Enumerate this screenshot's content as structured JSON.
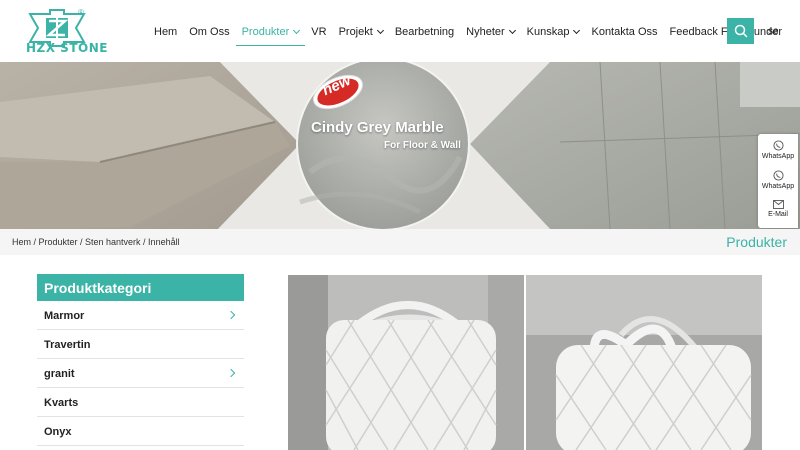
{
  "brand": {
    "name": "HZX STONE",
    "registered": "®",
    "color": "#3bb3a6"
  },
  "nav": {
    "items": [
      {
        "label": "Hem",
        "dropdown": false,
        "active": false
      },
      {
        "label": "Om Oss",
        "dropdown": false,
        "active": false
      },
      {
        "label": "Produkter",
        "dropdown": true,
        "active": true
      },
      {
        "label": "VR",
        "dropdown": false,
        "active": false
      },
      {
        "label": "Projekt",
        "dropdown": true,
        "active": false
      },
      {
        "label": "Bearbetning",
        "dropdown": false,
        "active": false
      },
      {
        "label": "Nyheter",
        "dropdown": true,
        "active": false
      },
      {
        "label": "Kunskap",
        "dropdown": true,
        "active": false
      },
      {
        "label": "Kontakta Oss",
        "dropdown": false,
        "active": false
      },
      {
        "label": "Feedback Från Kunder",
        "dropdown": false,
        "active": false
      }
    ],
    "search_icon": "search-icon",
    "lang": "se"
  },
  "banner": {
    "badge": "new",
    "title": "Cindy Grey Marble",
    "subtitle": "For Floor & Wall"
  },
  "side_float": {
    "items": [
      "WhatsApp",
      "WhatsApp",
      "E-Mail"
    ]
  },
  "breadcrumb": {
    "text": "Hem / Produkter / Sten hantverk / Innehåll",
    "page_title": "Produkter"
  },
  "categories": {
    "title": "Produktkategori",
    "items": [
      {
        "label": "Marmor",
        "has_sub": true
      },
      {
        "label": "Travertin",
        "has_sub": false
      },
      {
        "label": "granit",
        "has_sub": true
      },
      {
        "label": "Kvarts",
        "has_sub": false
      },
      {
        "label": "Onyx",
        "has_sub": false
      }
    ]
  }
}
